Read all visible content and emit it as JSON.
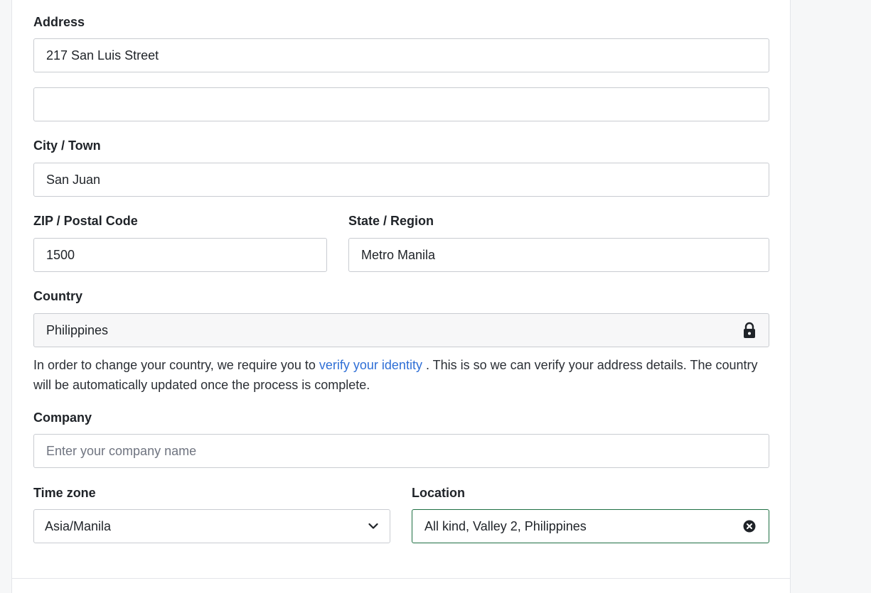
{
  "address": {
    "label": "Address",
    "line1_value": "217 San Luis Street",
    "line2_value": ""
  },
  "city": {
    "label": "City / Town",
    "value": "San Juan"
  },
  "zip": {
    "label": "ZIP / Postal Code",
    "value": "1500"
  },
  "state": {
    "label": "State / Region",
    "value": "Metro Manila"
  },
  "country": {
    "label": "Country",
    "value": "Philippines",
    "lock_icon": "lock-icon",
    "help_before": "In order to change your country, we require you to ",
    "help_link": "verify your identity",
    "help_after": " . This is so we can verify your address details. The country will be automatically updated once the process is complete."
  },
  "company": {
    "label": "Company",
    "placeholder": "Enter your company name",
    "value": ""
  },
  "timezone": {
    "label": "Time zone",
    "value": "Asia/Manila",
    "icon": "chevron-down-icon"
  },
  "location": {
    "label": "Location",
    "value": "All kind, Valley 2, Philippines",
    "icon": "clear-circle-icon"
  },
  "colors": {
    "link": "#2f6fd6",
    "focus_border": "#1f6f43",
    "border": "#c9ccd1"
  }
}
